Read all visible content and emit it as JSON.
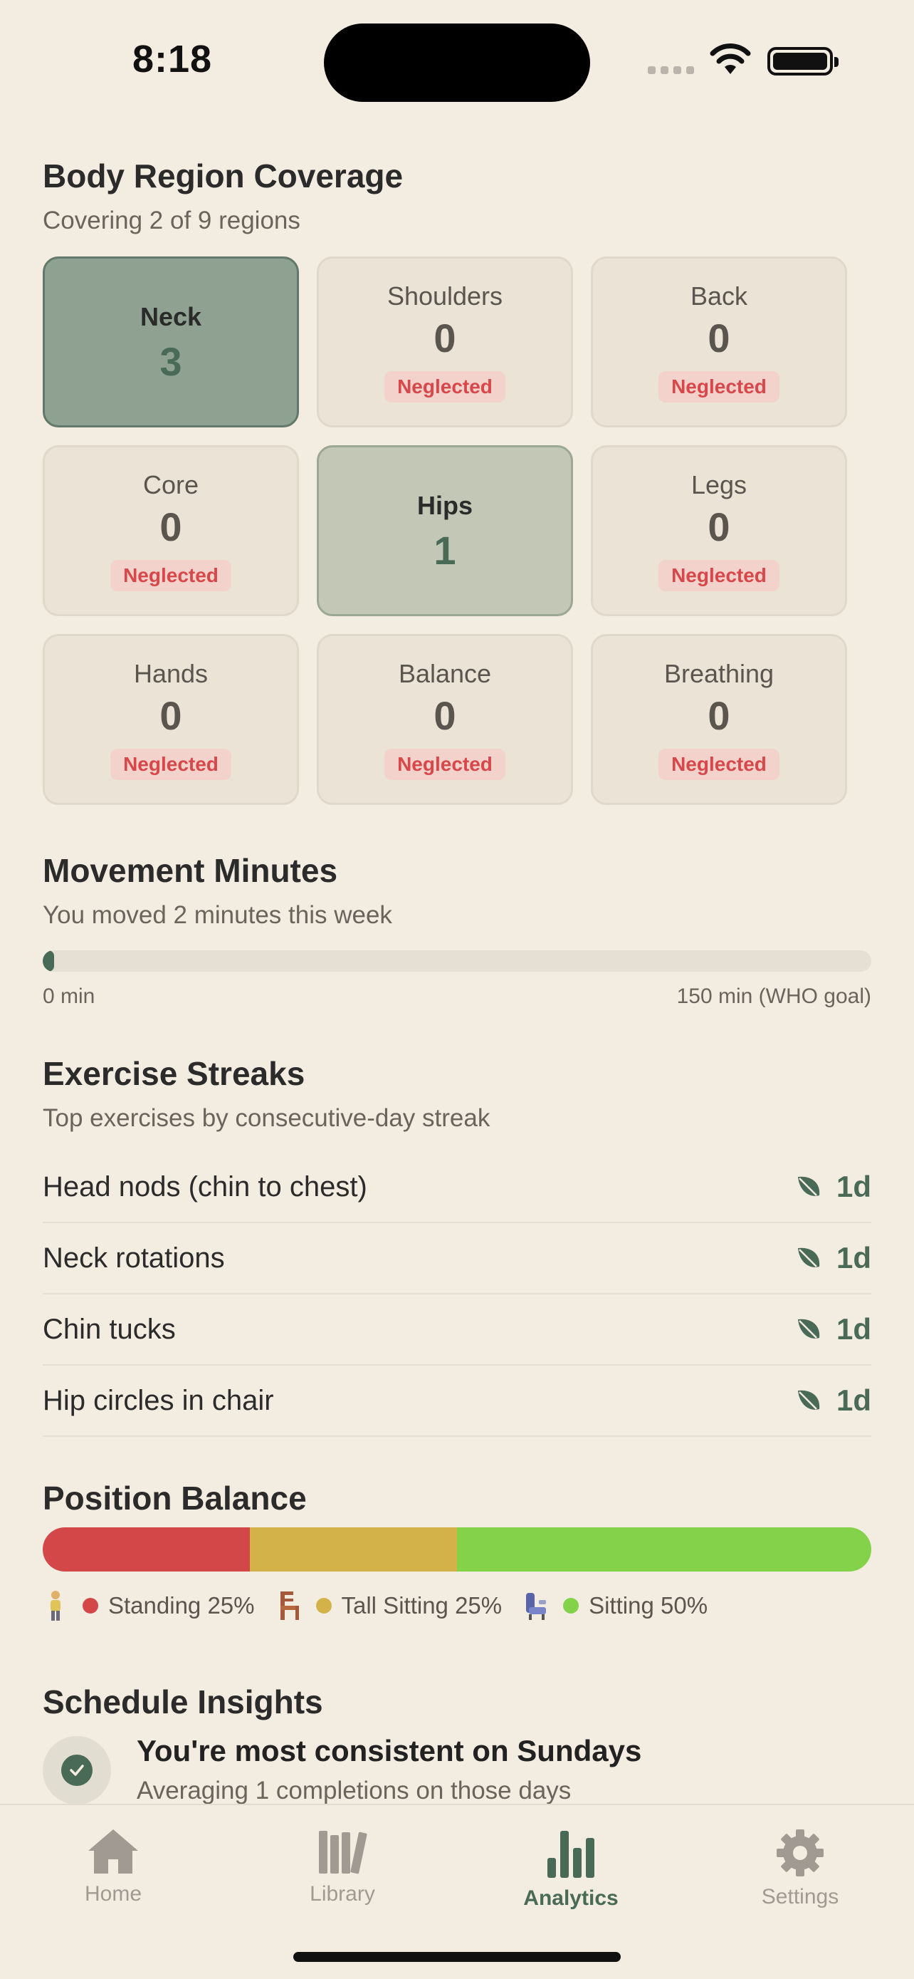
{
  "status_bar": {
    "time": "8:18"
  },
  "coverage": {
    "title": "Body Region Coverage",
    "subtitle": "Covering 2 of 9 regions",
    "regions": [
      {
        "name": "Neck",
        "count": "3",
        "badge": ""
      },
      {
        "name": "Shoulders",
        "count": "0",
        "badge": "Neglected"
      },
      {
        "name": "Back",
        "count": "0",
        "badge": "Neglected"
      },
      {
        "name": "Core",
        "count": "0",
        "badge": "Neglected"
      },
      {
        "name": "Hips",
        "count": "1",
        "badge": ""
      },
      {
        "name": "Legs",
        "count": "0",
        "badge": "Neglected"
      },
      {
        "name": "Hands",
        "count": "0",
        "badge": "Neglected"
      },
      {
        "name": "Balance",
        "count": "0",
        "badge": "Neglected"
      },
      {
        "name": "Breathing",
        "count": "0",
        "badge": "Neglected"
      }
    ]
  },
  "movement": {
    "title": "Movement Minutes",
    "subtitle": "You moved 2 minutes this week",
    "progress_minutes": 2,
    "goal_minutes": 150,
    "min_label": "0 min",
    "max_label": "150 min (WHO goal)"
  },
  "streaks": {
    "title": "Exercise Streaks",
    "subtitle": "Top exercises by consecutive-day streak",
    "items": [
      {
        "name": "Head nods (chin to chest)",
        "value": "1d"
      },
      {
        "name": "Neck rotations",
        "value": "1d"
      },
      {
        "name": "Chin tucks",
        "value": "1d"
      },
      {
        "name": "Hip circles in chair",
        "value": "1d"
      }
    ]
  },
  "position_balance": {
    "title": "Position Balance",
    "segments": [
      {
        "label": "Standing 25%",
        "percent": 25,
        "color": "#d44749",
        "icon": "standing-person-icon"
      },
      {
        "label": "Tall Sitting 25%",
        "percent": 25,
        "color": "#d4b24a",
        "icon": "chair-icon"
      },
      {
        "label": "Sitting 50%",
        "percent": 50,
        "color": "#84d14a",
        "icon": "seat-icon"
      }
    ]
  },
  "insights": {
    "title": "Schedule Insights",
    "headline": "You're most consistent on Sundays",
    "detail": "Averaging 1 completions on those days"
  },
  "tabs": [
    {
      "label": "Home",
      "icon": "home-icon"
    },
    {
      "label": "Library",
      "icon": "library-icon"
    },
    {
      "label": "Analytics",
      "icon": "analytics-icon"
    },
    {
      "label": "Settings",
      "icon": "gear-icon"
    }
  ],
  "colors": {
    "accent": "#4a6a58",
    "background": "#f3ece0",
    "neglected": "#d8474a"
  }
}
